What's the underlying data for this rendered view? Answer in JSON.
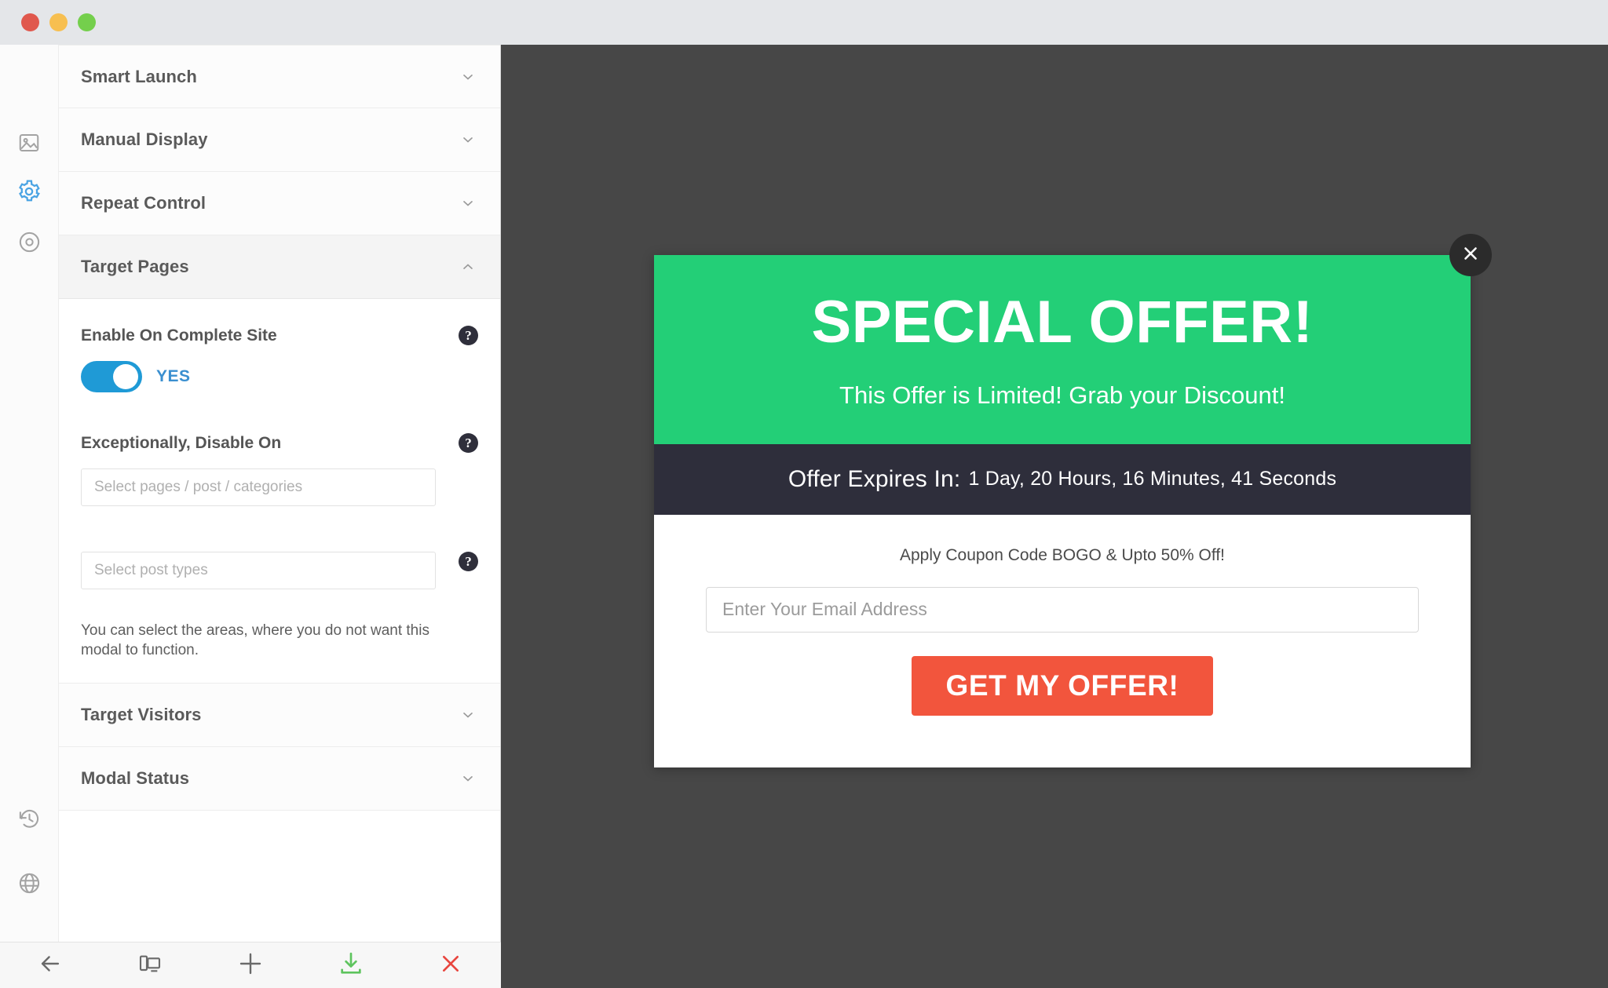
{
  "window": {
    "traffic_lights": [
      {
        "name": "close",
        "color": "#e0584d"
      },
      {
        "name": "minimize",
        "color": "#f7bf50"
      },
      {
        "name": "maximize",
        "color": "#74cf4c"
      }
    ]
  },
  "rail": {
    "items": [
      {
        "icon": "image-icon",
        "active": false
      },
      {
        "icon": "gear-icon",
        "active": true
      },
      {
        "icon": "target-icon",
        "active": false
      }
    ],
    "bottom_items": [
      {
        "icon": "history-icon"
      },
      {
        "icon": "globe-icon"
      }
    ]
  },
  "panel": {
    "sections": [
      {
        "title": "Smart Launch",
        "open": false
      },
      {
        "title": "Manual Display",
        "open": false
      },
      {
        "title": "Repeat Control",
        "open": false
      },
      {
        "title": "Target Pages",
        "open": true
      },
      {
        "title": "Target Visitors",
        "open": false
      },
      {
        "title": "Modal Status",
        "open": false
      }
    ],
    "target_pages": {
      "enable_label": "Enable On Complete Site",
      "toggle_value": "YES",
      "toggle_on": true,
      "disable_label": "Exceptionally, Disable On",
      "pages_placeholder": "Select pages / post / categories",
      "pages_value": "",
      "post_types_placeholder": "Select post types",
      "post_types_value": "",
      "hint": "You can select the areas, where you do not want this modal to function.",
      "help_icon": "question-mark-icon"
    }
  },
  "toolbar": {
    "buttons": [
      {
        "name": "back-button",
        "icon": "arrow-left-icon",
        "tone": "default"
      },
      {
        "name": "responsive-preview-button",
        "icon": "devices-icon",
        "tone": "default"
      },
      {
        "name": "add-button",
        "icon": "plus-icon",
        "tone": "default"
      },
      {
        "name": "save-button",
        "icon": "download-icon",
        "tone": "green"
      },
      {
        "name": "close-button",
        "icon": "close-x-icon",
        "tone": "red"
      }
    ]
  },
  "modal": {
    "headline": "SPECIAL OFFER!",
    "subheadline": "This Offer is Limited! Grab your Discount!",
    "timer_label": "Offer Expires In:",
    "timer_value": "1 Day, 20 Hours, 16 Minutes, 41 Seconds",
    "coupon_text": "Apply Coupon Code BOGO & Upto 50% Off!",
    "email_placeholder": "Enter Your Email Address",
    "email_value": "",
    "cta_label": "GET MY OFFER!",
    "close_icon": "close-x-icon",
    "colors": {
      "header_green": "#23cf77",
      "timer_dark": "#2e2e3b",
      "cta_orange": "#f2553d",
      "canvas_dark": "#474747"
    }
  }
}
